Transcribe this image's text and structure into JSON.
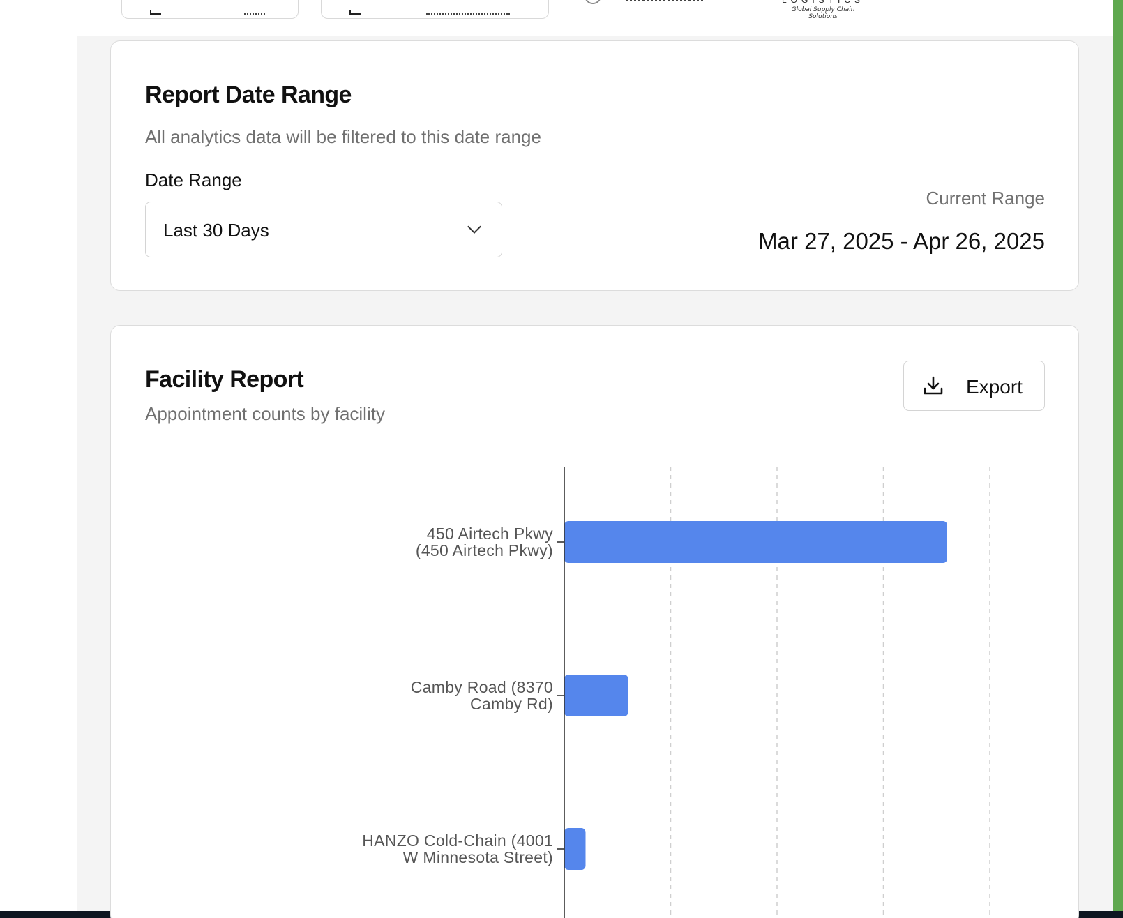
{
  "header": {
    "button_1_label": "",
    "button_2_label": "",
    "logo_tagline": "Global Supply Chain Solutions"
  },
  "date_card": {
    "title": "Report Date Range",
    "subtitle": "All analytics data will be filtered to this date range",
    "field_label": "Date Range",
    "select_value": "Last 30 Days",
    "current_range_label": "Current Range",
    "current_range_value": "Mar 27, 2025 - Apr 26, 2025"
  },
  "facility_card": {
    "title": "Facility Report",
    "subtitle": "Appointment counts by facility",
    "export_label": "Export"
  },
  "colors": {
    "bar": "#5586ec",
    "accent_green": "#5fa84f",
    "bottom_bar": "#0e1621"
  },
  "chart_data": {
    "type": "bar",
    "orientation": "horizontal",
    "title": "",
    "xlabel": "",
    "ylabel": "",
    "categories": [
      "450 Airtech Pkwy (450 Airtech Pkwy)",
      "Camby Road (8370 Camby Rd)",
      "HANZO Cold-Chain (4001 W Minnesota Street)"
    ],
    "category_lines": [
      [
        "450 Airtech Pkwy",
        "(450 Airtech Pkwy)"
      ],
      [
        "Camby Road (8370",
        "Camby Rd)"
      ],
      [
        "HANZO Cold-Chain (4001",
        "W Minnesota Street)"
      ]
    ],
    "values": [
      18,
      3,
      1
    ],
    "xlim": [
      0,
      20
    ],
    "x_grid_ticks": [
      5,
      10,
      15,
      20
    ],
    "grid": "vertical dashed",
    "legend": "none"
  }
}
